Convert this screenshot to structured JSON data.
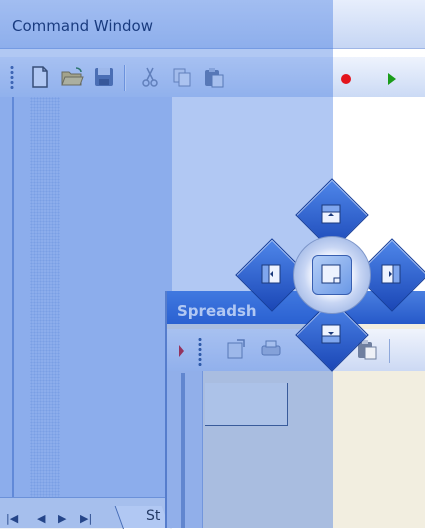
{
  "window": {
    "title": "Command Window"
  },
  "spreadsheet": {
    "title": "Spreadsh"
  },
  "bottom_tab": {
    "label": "St"
  },
  "toolbar_icons": [
    "new-document-icon",
    "open-folder-icon",
    "save-icon",
    "cut-icon",
    "copy-icon",
    "paste-icon",
    "record-icon",
    "play-icon"
  ],
  "spreadsheet_toolbar_icons": [
    "properties-icon",
    "print-icon",
    "copy-icon",
    "paste-icon"
  ],
  "dock_guide": [
    "dock-top-icon",
    "dock-left-icon",
    "dock-center-icon",
    "dock-right-icon",
    "dock-bottom-icon"
  ],
  "nav_buttons": [
    "first-page-icon",
    "previous-page-icon",
    "next-page-icon",
    "last-page-icon"
  ],
  "colors": {
    "overlay": "#316fe0",
    "record": "#e3141d",
    "play": "#1a9c1a",
    "title_bar": "#2659c9"
  }
}
